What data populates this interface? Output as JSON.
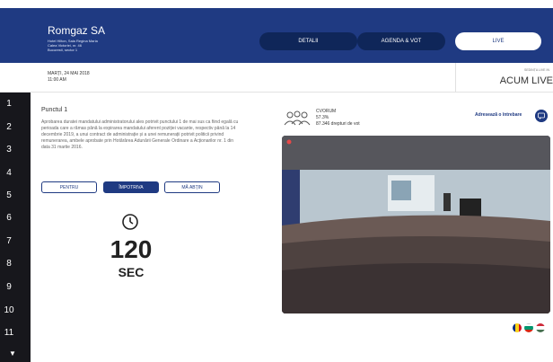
{
  "header": {
    "company": "Romgaz SA",
    "address_lines": [
      "Hotel Hilton, Sala Regina Maria",
      "Calea Victoriei, nr. 46",
      "Bucuresti, sector 1"
    ],
    "nav": [
      "DETALII",
      "AGENDA & VOT",
      "LIVE"
    ],
    "active_nav": "LIVE",
    "brand_color": "#1f3a82"
  },
  "session": {
    "date": "MARȚI, 24 MAI 2018",
    "time": "11:00 AM",
    "live_label": "SEDINȚA LIVE IN",
    "live_status": "ACUM LIVE"
  },
  "sidebar": {
    "items": [
      "1",
      "2",
      "3",
      "4",
      "5",
      "6",
      "7",
      "8",
      "9",
      "10",
      "11"
    ],
    "active": "1"
  },
  "point": {
    "title": "Punctul 1",
    "description": "Aprobarea duratei mandatului administratorului ales potrivit punctului 1 de mai sus ca fiind egală cu perioada care a rămas până la expirarea mandatului aferent poziției vacante, respectiv până la 14 decembrie 2019, a unui contract de administrație și a unei remunerații potrivit politicii privind remunerarea, ambele aprobate prin Hotărârea Adunării Generale Ordinare a Acționarilor nr. 1 din data 31 martie 2016.",
    "vote_options": [
      "PENTRU",
      "ÎMPOTRIVA",
      "MĂ ABȚIN"
    ],
    "selected_vote": "ÎMPOTRIVA",
    "timer_value": "120",
    "timer_unit": "SEC"
  },
  "quorum": {
    "label": "CVORUM",
    "percent": "57.3%",
    "rights": "87.346 drepturi de vot",
    "ask_label": "Adresează o întrebare"
  },
  "icons": {
    "clock": "clock-icon",
    "quorum": "people-group-icon",
    "chat": "chat-icon",
    "flags": [
      "romania-flag-icon",
      "bulgaria-flag-icon",
      "hungary-flag-icon"
    ]
  }
}
